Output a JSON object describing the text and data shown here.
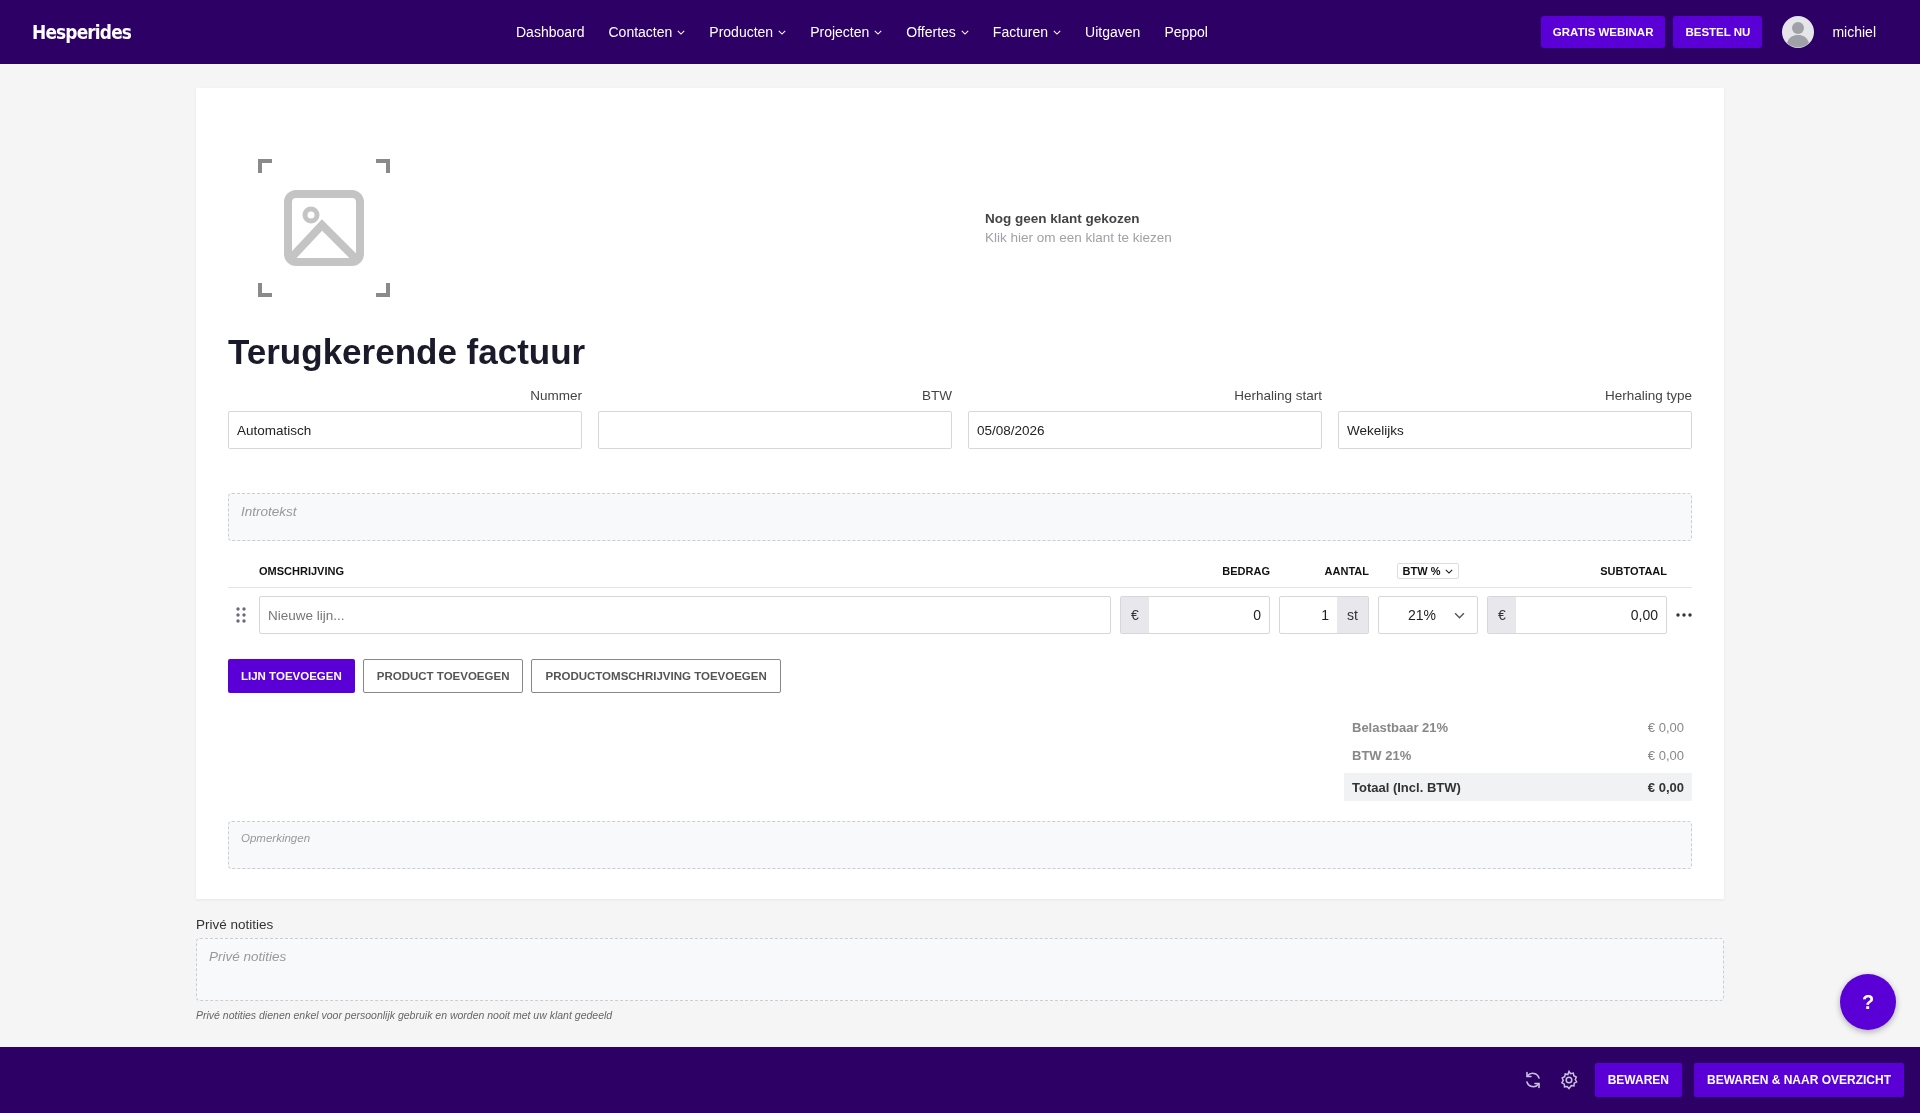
{
  "nav": {
    "logo": "Hesperides",
    "items": [
      {
        "label": "Dashboard",
        "dropdown": false
      },
      {
        "label": "Contacten",
        "dropdown": true
      },
      {
        "label": "Producten",
        "dropdown": true
      },
      {
        "label": "Projecten",
        "dropdown": true
      },
      {
        "label": "Offertes",
        "dropdown": true
      },
      {
        "label": "Facturen",
        "dropdown": true
      },
      {
        "label": "Uitgaven",
        "dropdown": false
      },
      {
        "label": "Peppol",
        "dropdown": false
      }
    ],
    "buttons": [
      "GRATIS WEBINAR",
      "BESTEL NU"
    ],
    "user": "michiel"
  },
  "client": {
    "title": "Nog geen klant gekozen",
    "hint": "Klik hier om een klant te kiezen"
  },
  "title": "Terugkerende factuur",
  "fields": [
    {
      "label": "Nummer",
      "value": "Automatisch"
    },
    {
      "label": "BTW"
    },
    {
      "label": "Herhaling start",
      "value": "05/08/2026"
    },
    {
      "label": "Herhaling type",
      "value": "Wekelijks"
    }
  ],
  "intro": {
    "placeholder": "Introtekst"
  },
  "table": {
    "columns": [
      {
        "label": "OMSCHRIJVING",
        "dropdown": false
      },
      {
        "label": "BEDRAG",
        "dropdown": false
      },
      {
        "label": "AANTAL",
        "dropdown": false
      },
      {
        "label": "BTW %",
        "dropdown": true
      },
      {
        "label": "SUBTOTAAL",
        "dropdown": false
      }
    ],
    "rows": [
      {
        "placeholder": "Nieuwe lijn...",
        "currency": "€",
        "amount": "0",
        "quantity": "1",
        "unit": "st",
        "vat": "21%",
        "subtotal_currency": "€",
        "subtotal": "0,00"
      }
    ]
  },
  "line_buttons": [
    {
      "label": "LIJN TOEVOEGEN",
      "primary": true
    },
    {
      "label": "PRODUCT TOEVOEGEN",
      "primary": false
    },
    {
      "label": "PRODUCTOMSCHRIJVING TOEVOEGEN",
      "primary": false
    }
  ],
  "totals": [
    {
      "label": "Belastbaar 21%",
      "value": "€ 0,00",
      "total": false
    },
    {
      "label": "BTW 21%",
      "value": "€ 0,00",
      "total": false
    },
    {
      "label": "Totaal (Incl. BTW)",
      "value": "€ 0,00",
      "total": true
    }
  ],
  "remarks": {
    "placeholder": "Opmerkingen"
  },
  "private_notes": {
    "label": "Privé notities",
    "placeholder": "Privé notities",
    "note": "Privé notities dienen enkel voor persoonlijk gebruik en worden nooit met uw klant gedeeld"
  },
  "footer": {
    "buttons": [
      "BEWAREN",
      "BEWAREN & NAAR OVERZICHT"
    ]
  },
  "help": "?"
}
